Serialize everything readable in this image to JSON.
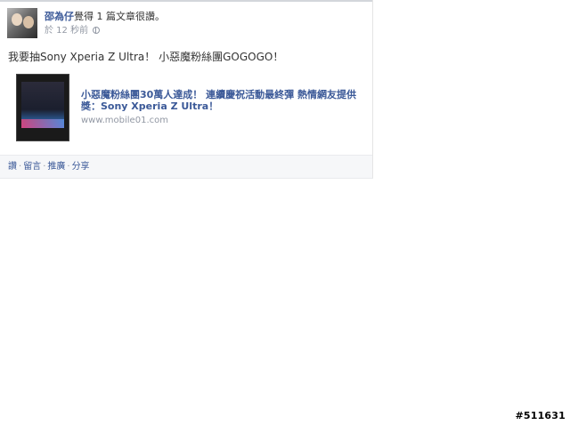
{
  "post": {
    "author": "邵為仔",
    "action_text": "覺得 1 篇文章很讚。",
    "time": "於 12 秒前",
    "privacy_icon": "globe-icon",
    "message": "我要抽Sony Xperia Z Ultra！ 小惡魔粉絲團GOGOGO！",
    "link_card": {
      "title": "小惡魔粉絲團30萬人達成！ 連續慶祝活動最終彈 熱情網友提供獎：Sony Xperia Z Ultra！",
      "domain": "www.mobile01.com"
    },
    "actions": {
      "like": "讚",
      "comment": "留言",
      "promote": "推廣",
      "share": "分享",
      "separator": "·"
    }
  },
  "watermark": "#511631",
  "colors": {
    "link": "#3b5998",
    "meta": "#9197a3",
    "bar_bg": "#f6f7f9"
  }
}
